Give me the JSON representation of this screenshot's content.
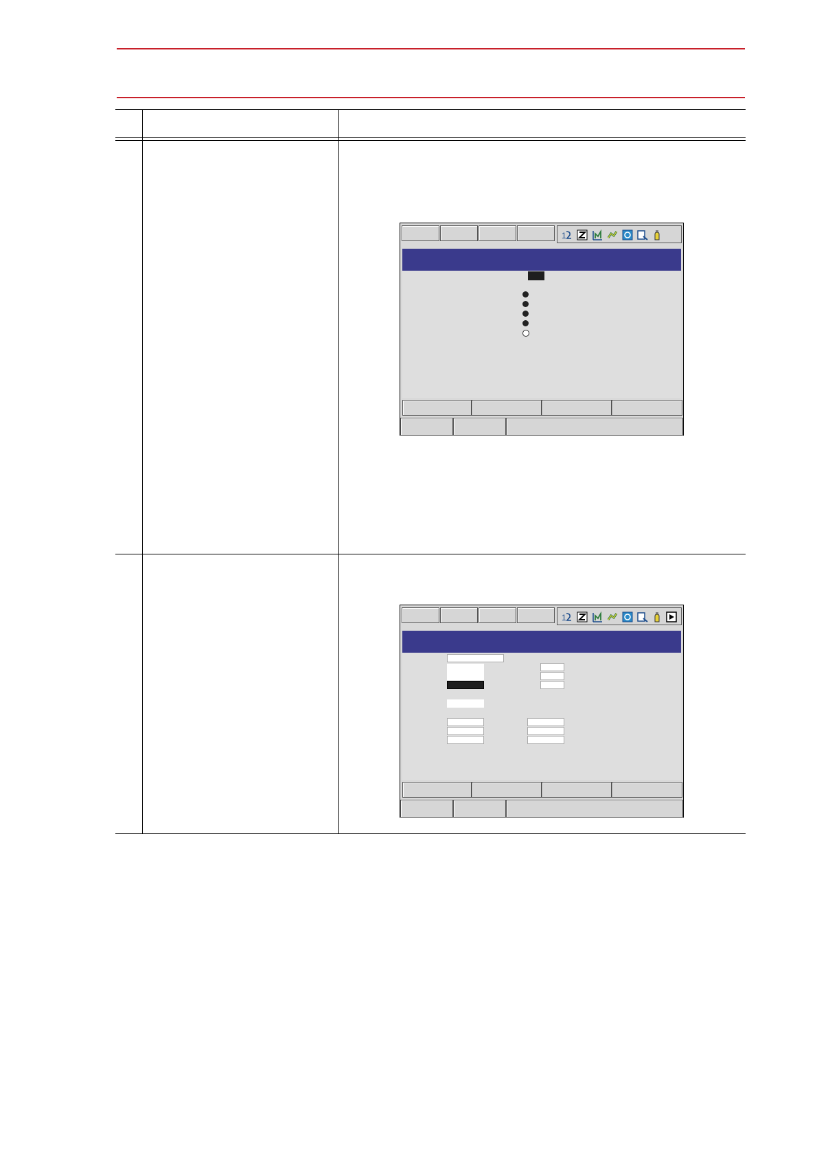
{
  "page": {},
  "screen1": {
    "icons": [
      "number-icon",
      "z-icon",
      "chart-icon",
      "robot-icon",
      "cycle-icon",
      "edit-icon",
      "hand-icon"
    ],
    "dots": [
      "filled",
      "filled",
      "filled",
      "filled",
      "open"
    ]
  },
  "screen2": {
    "icons": [
      "number-icon",
      "z-icon",
      "chart-icon",
      "robot-icon",
      "cycle-icon",
      "edit-icon",
      "hand-icon",
      "play-icon"
    ]
  },
  "colors": {
    "rule": "#c8202a",
    "titlebar": "#3a3a8c",
    "screen_bg": "#d9d9d9"
  }
}
